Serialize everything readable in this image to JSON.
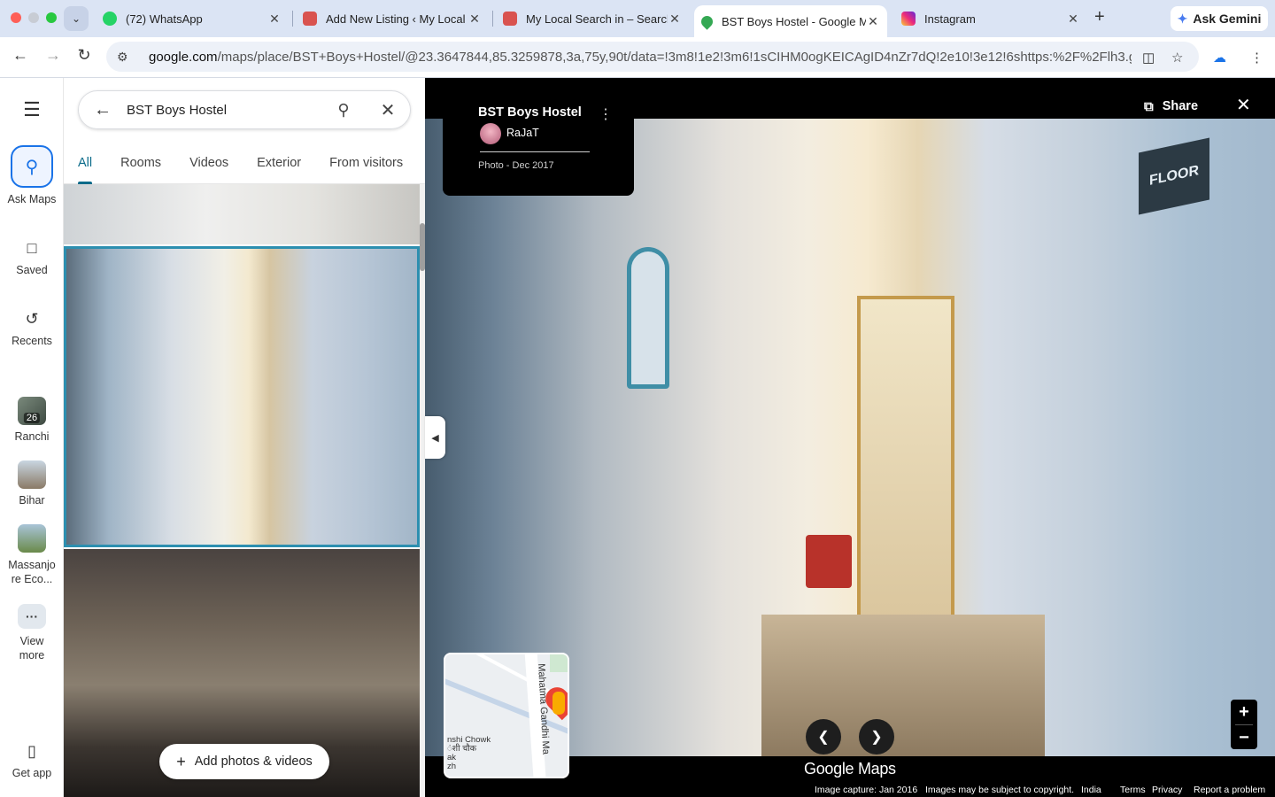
{
  "browser": {
    "tabs": [
      {
        "title": "(72) WhatsApp",
        "favicon_color": "#25d366"
      },
      {
        "title": "Add New Listing ‹ My Local",
        "favicon_color": "#d9534f"
      },
      {
        "title": "My Local Search in – Search",
        "favicon_color": "#d9534f"
      },
      {
        "title": "BST Boys Hostel - Google M",
        "favicon_color": "#34a853"
      },
      {
        "title": "Instagram",
        "favicon_color": "#e1306c"
      }
    ],
    "new_tab_symbol": "+",
    "gemini_label": "Ask Gemini",
    "url_host": "google.com",
    "url_path": "/maps/place/BST+Boys+Hostel/@23.3647844,85.3259878,3a,75y,90t/data=!3m8!1e2!3m6!1sCIHM0ogKEICAgID4nZr7dQ!2e10!3e12!6shttps:%2F%2Flh3.g..."
  },
  "rail": {
    "ask_maps": "Ask Maps",
    "saved": "Saved",
    "recents": "Recents",
    "ranchi": "Ranchi",
    "ranchi_badge": "26",
    "bihar": "Bihar",
    "massanjore_line1": "Massanjo",
    "massanjore_line2": "re Eco...",
    "view_more_line1": "View",
    "view_more_line2": "more",
    "get_app": "Get app"
  },
  "search": {
    "query": "BST Boys Hostel"
  },
  "photo_tabs": [
    "All",
    "Rooms",
    "Videos",
    "Exterior",
    "From visitors"
  ],
  "add_photos_label": "Add photos & videos",
  "viewer": {
    "place_name": "BST Boys Hostel",
    "author": "RaJaT",
    "photo_meta": "Photo - Dec 2017",
    "share_label": "Share",
    "sign_text": "FLOOR",
    "minimap_street": "Mahatma Gandhi Ma",
    "minimap_chowk": "nshi Chowk\nंशी चौक\nak\nzh",
    "logo": "Google Maps",
    "footer": {
      "capture": "Image capture: Jan 2016",
      "copyright": "Images may be subject to copyright.",
      "country": "India",
      "terms": "Terms",
      "privacy": "Privacy",
      "report": "Report a problem"
    }
  },
  "colors": {
    "accent": "#0b6b8a",
    "ask_maps_blue": "#1a73e8",
    "tabbar_bg": "#dbe4f4"
  },
  "icons": [
    "menu-icon",
    "sparkle-search-icon",
    "bookmark-icon",
    "history-icon",
    "phone-icon",
    "back-arrow-icon",
    "search-icon",
    "close-icon",
    "share-icon",
    "kebab-icon",
    "chevron-left-icon",
    "chevron-right-icon",
    "plus-icon",
    "minus-icon"
  ]
}
